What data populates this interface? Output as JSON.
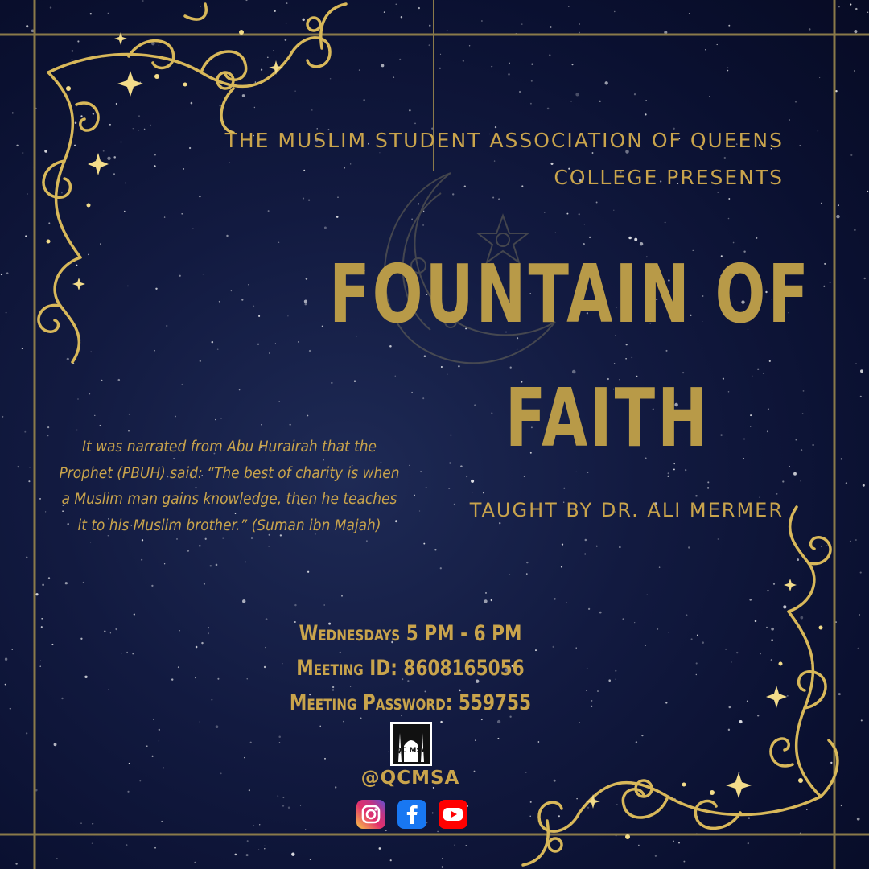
{
  "presenter": "THE MUSLIM STUDENT ASSOCIATION OF QUEENS\nCOLLEGE PRESENTS",
  "title_line1": "FOUNTAIN OF",
  "title_line2": "FAITH",
  "teacher": "TAUGHT BY DR. ALI MERMER",
  "quote": "It was narrated from Abu Hurairah that the Prophet (PBUH) said: “The best of charity is when a Muslim man gains knowledge, then he teaches it to his Muslim brother.” (Suman ibn Majah)",
  "schedule": "Wednesdays 5 PM - 6 PM",
  "meeting_id": "Meeting ID: 8608165056",
  "meeting_password": "Meeting Password: 559755",
  "logo_text": "QC MSA",
  "handle": "@QCMSA",
  "social_icons": [
    "instagram-icon",
    "facebook-icon",
    "youtube-icon"
  ],
  "colors": {
    "background": "#0d1433",
    "gold": "#c9a44c",
    "title_gold": "#b89a48",
    "frame_line": "#8a7a4a"
  }
}
